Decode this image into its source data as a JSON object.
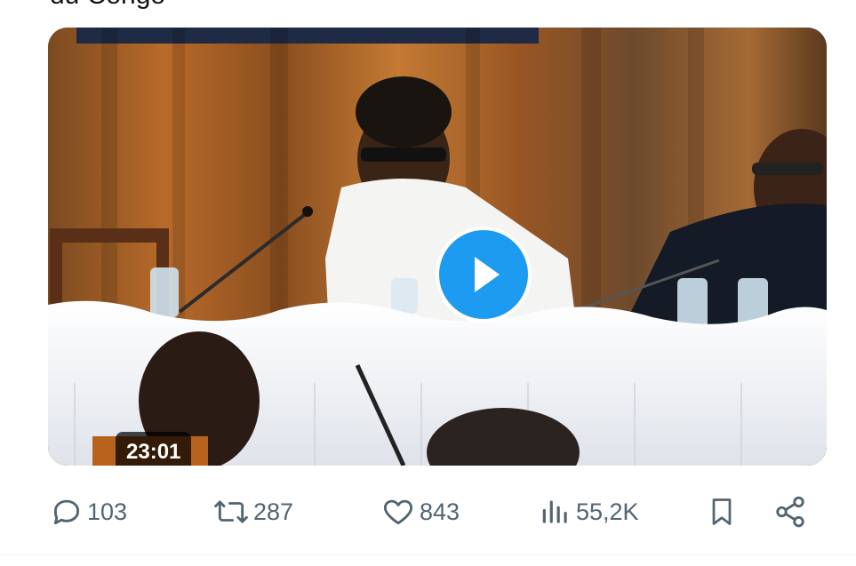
{
  "post": {
    "title_fragment": "du Congo",
    "video": {
      "duration": "23:01",
      "play_icon": "play-icon"
    }
  },
  "actions": {
    "reply": {
      "icon": "reply-icon",
      "count": "103"
    },
    "repost": {
      "icon": "repost-icon",
      "count": "287"
    },
    "like": {
      "icon": "heart-icon",
      "count": "843"
    },
    "views": {
      "icon": "views-icon",
      "count": "55,2K"
    },
    "bookmark": {
      "icon": "bookmark-icon"
    },
    "share": {
      "icon": "share-icon"
    }
  },
  "colors": {
    "accent": "#1d9bf0",
    "muted_text": "#536471",
    "text": "#0f1419"
  }
}
